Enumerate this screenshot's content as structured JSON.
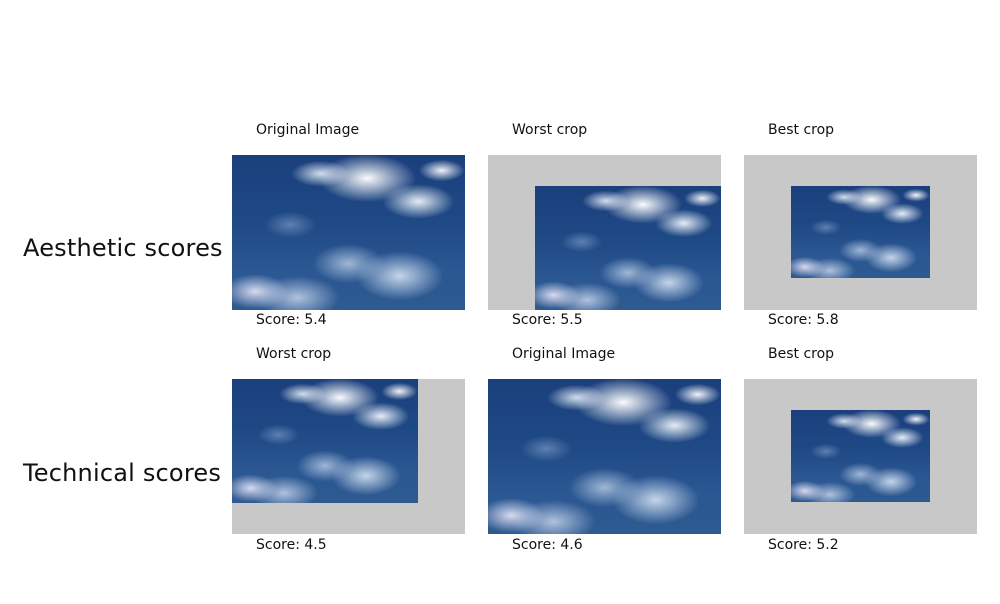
{
  "rows": [
    {
      "label": "Aesthetic scores",
      "panels": [
        {
          "caption": "Original Image",
          "score": "Score: 5.4"
        },
        {
          "caption": "Worst crop",
          "score": "Score: 5.5"
        },
        {
          "caption": "Best crop",
          "score": "Score: 5.8"
        }
      ]
    },
    {
      "label": "Technical scores",
      "panels": [
        {
          "caption": "Worst crop",
          "score": "Score: 4.5"
        },
        {
          "caption": "Original Image",
          "score": "Score: 4.6"
        },
        {
          "caption": "Best crop",
          "score": "Score: 5.2"
        }
      ]
    }
  ],
  "colors": {
    "panel_background": "#c8c8c8",
    "sky_dark": "#1b3f7c",
    "cloud_light": "#ffffff"
  },
  "image_content": "sky-with-clouds-photo"
}
